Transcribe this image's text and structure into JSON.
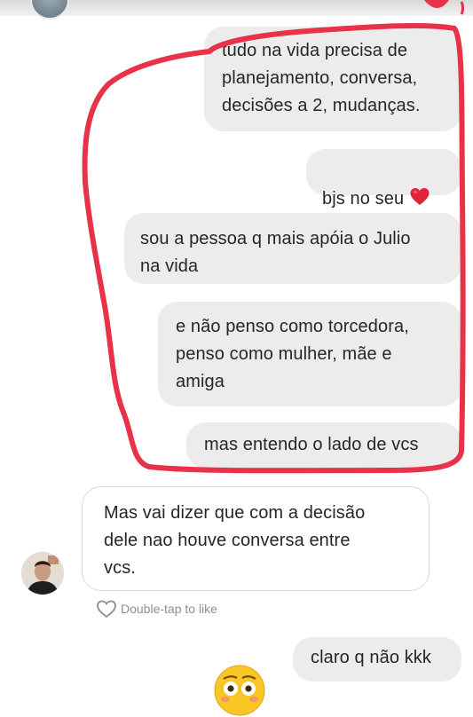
{
  "messages": [
    {
      "text": "tudo na vida precisa de\nplanejamento, conversa,\ndecisões a 2, mudanças."
    },
    {
      "text": "bjs no seu",
      "emoji": "red-heart-emoji"
    },
    {
      "text": "sou a pessoa q mais apóia o Julio\nna vida"
    },
    {
      "text": "e não penso como torcedora,\npenso como mulher, mãe e\namiga"
    },
    {
      "text": "mas entendo o lado de vcs"
    },
    {
      "text": "Mas vai dizer que com a decisão\ndele nao houve conversa entre\nvcs."
    },
    {
      "text": "claro q não kkk"
    }
  ],
  "like_hint": "Double-tap to like",
  "icons": {
    "heart_outline": "heart-outline-icon",
    "reaction": "flushed-face-emoji"
  },
  "colors": {
    "annotation_stroke": "#e8324a",
    "sent_bubble": "#ececec"
  }
}
